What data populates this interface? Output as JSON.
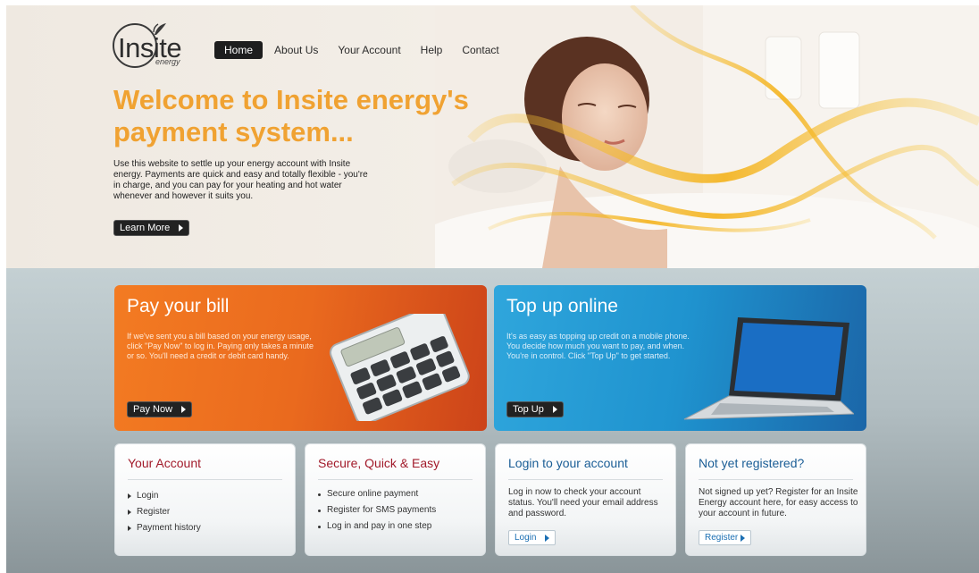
{
  "logo": {
    "name": "Insite",
    "sub": "energy"
  },
  "nav": [
    {
      "label": "Home",
      "active": true
    },
    {
      "label": "About Us"
    },
    {
      "label": "Your Account"
    },
    {
      "label": "Help"
    },
    {
      "label": "Contact"
    }
  ],
  "hero": {
    "title": "Welcome to Insite energy's payment system...",
    "text": "Use this website to settle up your energy account with Insite energy. Payments are quick and easy and totally flexible - you're in charge, and you can pay for your heating and hot water whenever and however it suits you.",
    "button": "Learn More"
  },
  "pay": {
    "title": "Pay your bill",
    "text": "If we've sent you a bill based on your energy usage, click \"Pay Now\" to log in. Paying only takes a minute or so. You'll need a credit or debit card handy.",
    "button": "Pay Now"
  },
  "topup": {
    "title": "Top up online",
    "text": "It's as easy as topping up credit on a mobile phone. You decide how much you want to pay, and when. You're in control. Click \"Top Up\" to get started.",
    "button": "Top Up"
  },
  "cards": {
    "account": {
      "title": "Your Account",
      "items": [
        "Login",
        "Register",
        "Payment history"
      ]
    },
    "secure": {
      "title": "Secure, Quick & Easy",
      "items": [
        "Secure online payment",
        "Register for SMS payments",
        "Log in and pay in one step"
      ]
    },
    "login": {
      "title": "Login to your account",
      "text": "Log in now to check your account status. You'll need your email address and password.",
      "button": "Login"
    },
    "register": {
      "title": "Not yet registered?",
      "text": "Not signed up yet? Register for an Insite Energy account here, for easy access to your account in future.",
      "button": "Register"
    }
  },
  "colors": {
    "accent_orange": "#f0a232",
    "pay_panel": "#ea6a1e",
    "topup_panel": "#1f93cf",
    "card_title_red": "#a21a2a",
    "card_title_blue": "#1b5e96"
  }
}
